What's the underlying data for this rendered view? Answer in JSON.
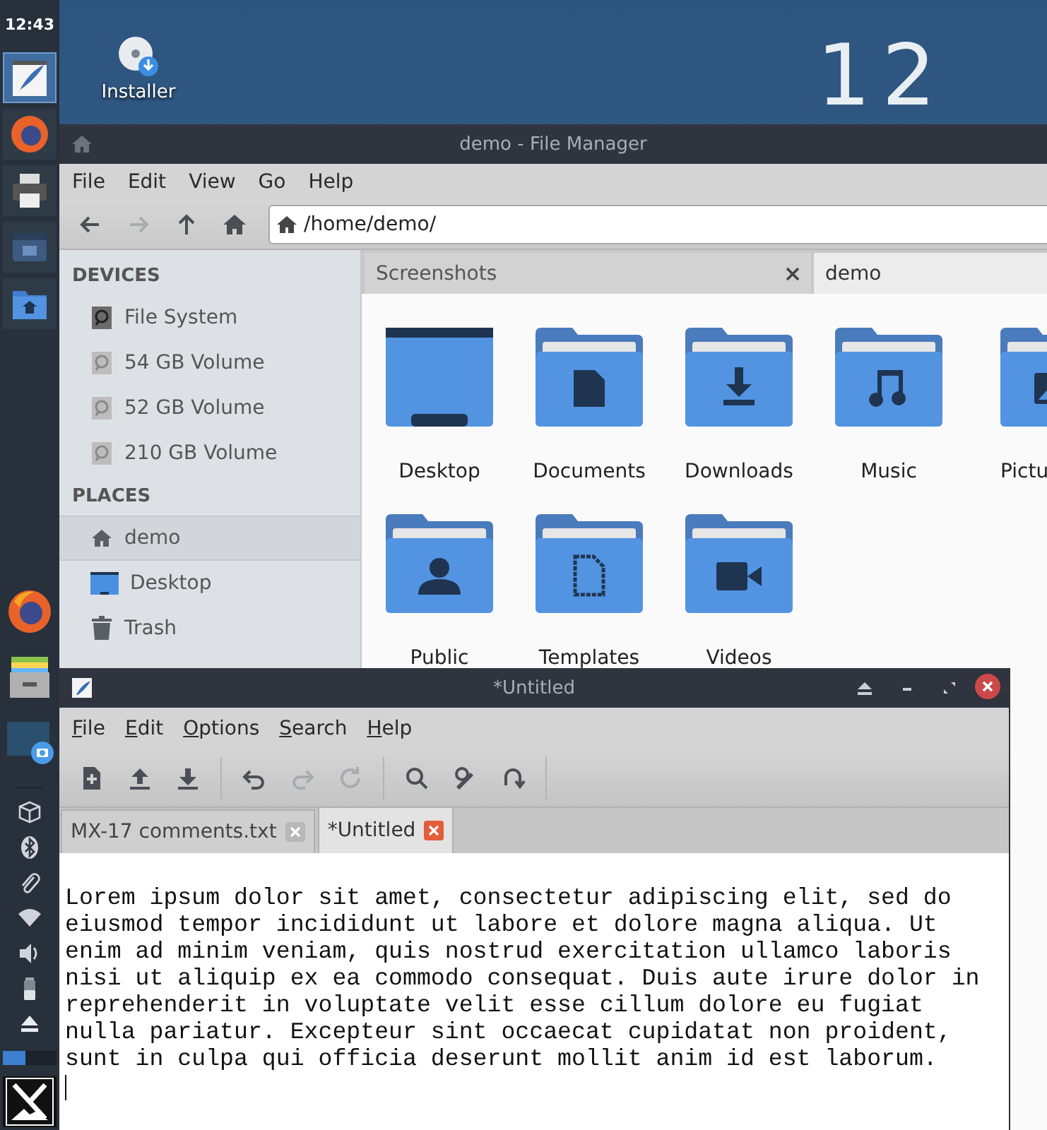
{
  "panel": {
    "clock": "12:43",
    "launchers": [
      {
        "kind": "editor",
        "active": true
      },
      {
        "kind": "browser",
        "active": false
      },
      {
        "kind": "printer",
        "active": false
      },
      {
        "kind": "window",
        "active": false
      },
      {
        "kind": "home-folder",
        "active": false
      }
    ],
    "dock": [
      {
        "kind": "browser"
      },
      {
        "kind": "files"
      },
      {
        "kind": "screenshot"
      }
    ],
    "tray": [
      {
        "kind": "package"
      },
      {
        "kind": "bluetooth"
      },
      {
        "kind": "paperclip"
      },
      {
        "kind": "wifi"
      },
      {
        "kind": "volume"
      },
      {
        "kind": "battery"
      },
      {
        "kind": "eject"
      }
    ]
  },
  "desktop": {
    "clock": "12",
    "icons": [
      {
        "label": "Installer"
      }
    ]
  },
  "file_manager": {
    "title": "demo - File Manager",
    "menu": [
      "File",
      "Edit",
      "View",
      "Go",
      "Help"
    ],
    "toolbar": [
      {
        "kind": "back",
        "disabled": false
      },
      {
        "kind": "forward",
        "disabled": true
      },
      {
        "kind": "up",
        "disabled": false
      },
      {
        "kind": "home",
        "disabled": false
      }
    ],
    "address": "/home/demo/",
    "sidebar": [
      {
        "heading": "DEVICES",
        "items": [
          {
            "label": "File System",
            "kind": "drive",
            "mounted": true,
            "selected": false
          },
          {
            "label": "54 GB Volume",
            "kind": "drive",
            "mounted": false,
            "selected": false
          },
          {
            "label": "52 GB Volume",
            "kind": "drive",
            "mounted": false,
            "selected": false
          },
          {
            "label": "210 GB Volume",
            "kind": "drive",
            "mounted": false,
            "selected": false
          }
        ]
      },
      {
        "heading": "PLACES",
        "items": [
          {
            "label": "demo",
            "kind": "home",
            "selected": true
          },
          {
            "label": "Desktop",
            "kind": "desktop",
            "selected": false
          },
          {
            "label": "Trash",
            "kind": "trash",
            "selected": false
          }
        ]
      }
    ],
    "tabs": [
      {
        "label": "Screenshots",
        "selected": false,
        "closable": true
      },
      {
        "label": "demo",
        "selected": true,
        "closable": false
      }
    ],
    "folders": [
      {
        "label": "Desktop",
        "kind": "desktop"
      },
      {
        "label": "Documents",
        "kind": "documents"
      },
      {
        "label": "Downloads",
        "kind": "downloads"
      },
      {
        "label": "Music",
        "kind": "music"
      },
      {
        "label": "Pictu",
        "kind": "pictures"
      },
      {
        "label": "Public",
        "kind": "public"
      },
      {
        "label": "Templates",
        "kind": "templates"
      },
      {
        "label": "Videos",
        "kind": "videos"
      }
    ]
  },
  "editor": {
    "title": "*Untitled",
    "controls": [
      {
        "kind": "shade"
      },
      {
        "kind": "minimize"
      },
      {
        "kind": "maximize"
      },
      {
        "kind": "close"
      }
    ],
    "menu": [
      "File",
      "Edit",
      "Options",
      "Search",
      "Help"
    ],
    "toolbar": [
      {
        "buttons": [
          {
            "kind": "new",
            "disabled": false
          },
          {
            "kind": "open",
            "disabled": false
          },
          {
            "kind": "save",
            "disabled": false
          }
        ]
      },
      {
        "buttons": [
          {
            "kind": "undo",
            "disabled": false
          },
          {
            "kind": "redo",
            "disabled": true
          },
          {
            "kind": "reload",
            "disabled": true
          }
        ]
      },
      {
        "buttons": [
          {
            "kind": "find",
            "disabled": false
          },
          {
            "kind": "replace",
            "disabled": false
          },
          {
            "kind": "jump",
            "disabled": false
          }
        ]
      }
    ],
    "tabs": [
      {
        "label": "MX-17 comments.txt",
        "selected": false
      },
      {
        "label": "*Untitled",
        "selected": true
      }
    ],
    "text": "Lorem ipsum dolor sit amet, consectetur adipiscing elit, sed do eiusmod tempor incididunt ut labore et dolore magna aliqua. Ut enim ad minim veniam, quis nostrud exercitation ullamco laboris nisi ut aliquip ex ea commodo consequat. Duis aute irure dolor in reprehenderit in voluptate velit esse cillum dolore eu fugiat nulla pariatur. Excepteur sint occaecat cupidatat non proident, sunt in culpa qui officia deserunt mollit anim id est laborum."
  }
}
